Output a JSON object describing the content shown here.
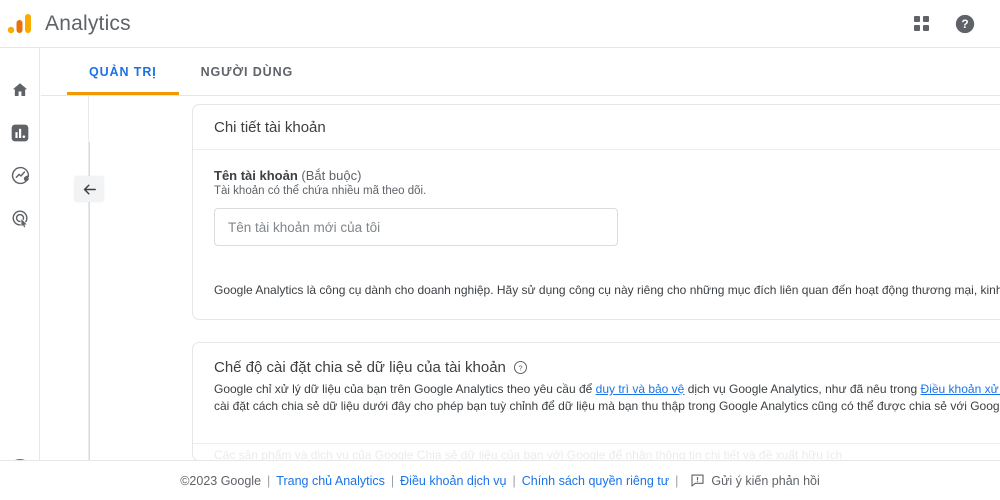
{
  "app": {
    "title": "Analytics",
    "logo_colors": {
      "dot": "#f9ab00",
      "bar_mid": "#e8710a",
      "bar_tall": "#f9ab00"
    }
  },
  "topbar": {
    "apps_icon": "apps-grid-icon",
    "help_icon": "help-circle-icon"
  },
  "rail": {
    "items": [
      {
        "name": "home-icon",
        "label": "Trang chủ",
        "active": false
      },
      {
        "name": "reports-icon",
        "label": "Báo cáo",
        "active": true
      },
      {
        "name": "explore-icon",
        "label": "Khám phá",
        "active": false
      },
      {
        "name": "advertising-icon",
        "label": "Quảng cáo",
        "active": false
      }
    ],
    "admin": {
      "name": "gear-icon",
      "label": "Quản trị",
      "color": "#1a73e8",
      "active": true
    }
  },
  "tabs": [
    {
      "label": "QUẢN TRỊ",
      "active": true
    },
    {
      "label": "NGƯỜI DÙNG",
      "active": false
    }
  ],
  "tab_accent": "#f29900",
  "tab_active_color": "#1a73e8",
  "navpane": {
    "collapse_icon": "arrow-left-icon"
  },
  "account_details": {
    "card_title": "Chi tiết tài khoản",
    "field_label": "Tên tài khoản",
    "field_required": "(Bắt buộc)",
    "field_hint": "Tài khoản có thể chứa nhiều mã theo dõi.",
    "input_value": "",
    "input_placeholder": "Tên tài khoản mới của tôi",
    "notice": "Google Analytics là công cụ dành cho doanh nghiệp. Hãy sử dụng công cụ này riêng cho những mục đích liên quan đến hoạt động thương mại, kinh doanh, thủ công hoặc nghề nghiệp."
  },
  "data_sharing": {
    "title": "Chế độ cài đặt chia sẻ dữ liệu của tài khoản",
    "help_icon": "help-circle-outline-icon",
    "para_1": "Google chỉ xử lý dữ liệu của bạn trên Google Analytics theo yêu cầu để ",
    "link_1": "duy trì và bảo vệ",
    "para_2": " dịch vụ Google Analytics, như đã nêu trong ",
    "link_2": "Điều khoản xử lý dữ liệu của Google Ads",
    "para_3": ". Các chế độ cài đặt cách chia sẻ dữ liệu dưới đây cho phép bạn tuỳ chỉnh để dữ liệu mà bạn thu thập trong Google Analytics cũng có thể được chia sẻ với Google cho các mục đích khác.",
    "ghost_row": "Các sản phẩm và dịch vụ của Google  Chia sẻ dữ liệu của bạn với Google để nhận thông tin chi tiết và đề xuất hữu ích"
  },
  "footer": {
    "copyright": "©2023 Google",
    "links": [
      "Trang chủ Analytics",
      "Điều khoản dịch vụ",
      "Chính sách quyền riêng tư"
    ],
    "feedback_icon": "feedback-icon",
    "feedback_label": "Gửi ý kiến phản hồi",
    "separator": "|"
  }
}
